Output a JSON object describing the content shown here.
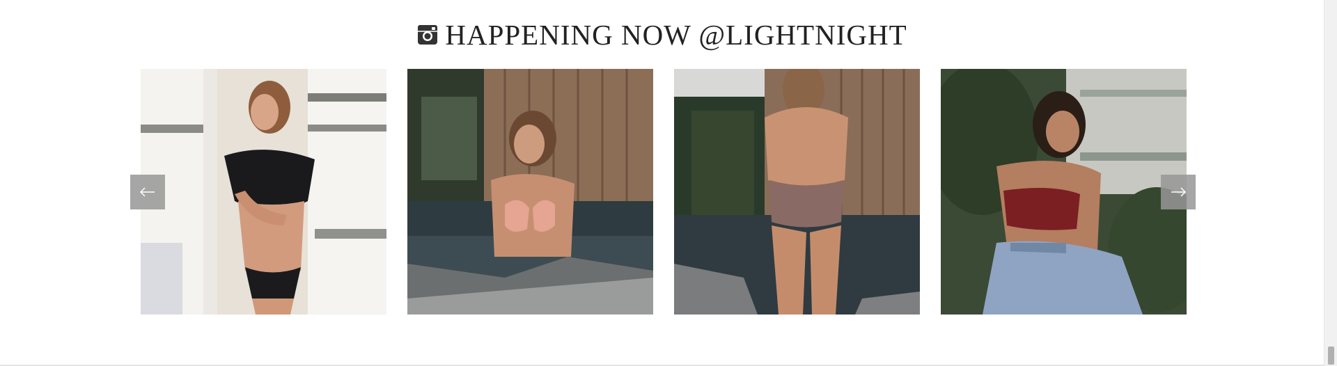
{
  "section": {
    "title": "HAPPENING NOW @LIGHTNIGHT",
    "icon": "instagram-icon"
  },
  "carousel": {
    "prev_icon": "arrow-left-icon",
    "next_icon": "arrow-right-icon",
    "photos": [
      {
        "subject": "woman in black top and black bikini bottoms by sheer curtains"
      },
      {
        "subject": "woman in pink bikini top in a pool"
      },
      {
        "subject": "woman in patterned bikini standing in pool, back view"
      },
      {
        "subject": "woman in burgundy bralette and jeans seated among plants"
      }
    ]
  },
  "colors": {
    "title": "#222222",
    "arrow_bg": "#969696",
    "arrow_fg": "#ffffff"
  }
}
